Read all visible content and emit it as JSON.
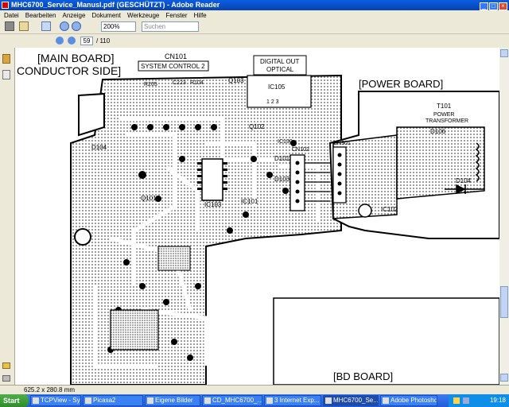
{
  "window": {
    "title": "MHC6700_Service_Manusl.pdf (GESCHÜTZT) - Adobe Reader"
  },
  "menu": [
    "Datei",
    "Bearbeiten",
    "Anzeige",
    "Dokument",
    "Werkzeuge",
    "Fenster",
    "Hilfe"
  ],
  "toolbar": {
    "zoom": "200%",
    "search_placeholder": "Suchen",
    "page_current": "59",
    "page_total": "/ 110"
  },
  "document": {
    "main_board_title": "[MAIN BOARD]",
    "main_board_subtitle": "CONDUCTOR SIDE]",
    "cn101": "CN101",
    "system_control": "SYSTEM CONTROL 2",
    "digital_out": "DIGITAL OUT",
    "optical": "OPTICAL",
    "power_board": "[POWER BOARD]",
    "power_transformer": "POWER",
    "transformer": "TRANSFORMER",
    "t101": "T101",
    "bd_board": "[BD BOARD]",
    "parts": {
      "r205": "R205",
      "c223": "C223",
      "r104": "R104",
      "q103": "Q103",
      "ic105": "IC105",
      "q102": "Q102",
      "d101": "D101",
      "ic103": "IC103",
      "q101": "Q101",
      "ic101": "IC101",
      "cn102": "CN102",
      "cn901": "CN901",
      "ic102": "IC102",
      "d106": "D106",
      "d104": "D104",
      "d103": "D103",
      "ic130": "IC130",
      "d104b": "D104",
      "pin123": "1 2 3"
    }
  },
  "status": {
    "page_size": "625.2 x 280.8 mm"
  },
  "taskbar": {
    "start": "Start",
    "items": [
      "TCPView - Sysi...",
      "Picasa2",
      "Eigene Bilder",
      "CD_MHC6700_...",
      "3 Internet Exp...",
      "MHC6700_Se...",
      "Adobe Photoshop"
    ],
    "clock": "19:18"
  }
}
